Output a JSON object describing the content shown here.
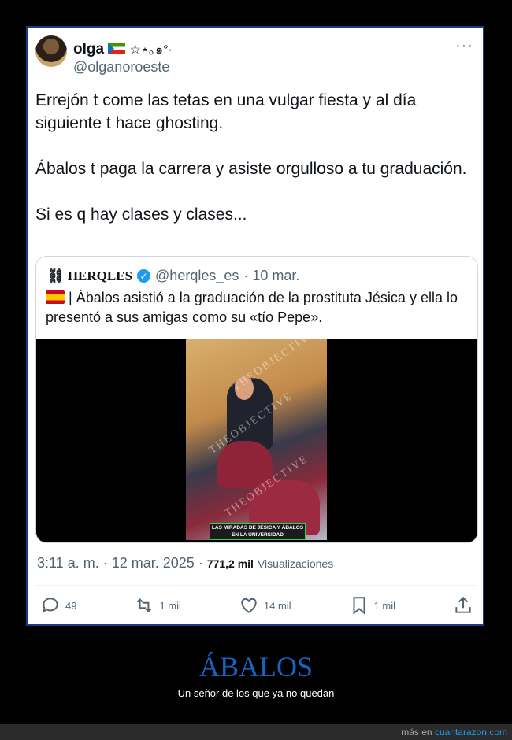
{
  "tweet": {
    "display_name": "olga",
    "name_decor": "☆⋆｡๑°·",
    "handle": "@olganoroeste",
    "more": "···",
    "paragraphs": [
      "Errejón t come las tetas en una vulgar fiesta y al día siguiente t hace ghosting.",
      "Ábalos t paga la carrera y asiste orgulloso a tu graduación.",
      "Si es q hay clases y clases..."
    ],
    "time": "3:11 a. m. · 12 mar. 2025 ·",
    "views_count": "771,2 mil",
    "views_label": "Visualizaciones"
  },
  "quote": {
    "logo": "⛓ HERQLES",
    "handle": "@herqles_es",
    "date": "· 10 mar.",
    "text": "| Ábalos asistió a la graduación de la prostituta Jésica y ella lo presentó a sus amigas como su «tío Pepe».",
    "video_caption": "LAS MIRADAS DE JÉSICA Y ÁBALOS EN LA UNIVERSIDAD",
    "watermark": "THEOBJECTIVE"
  },
  "actions": {
    "replies": "49",
    "retweets": "1 mil",
    "likes": "14 mil",
    "bookmarks": "1 mil"
  },
  "site": {
    "title": "ÁBALOS",
    "subtitle": "Un señor de los que ya no quedan",
    "footer_prefix": "más en",
    "footer_link": "cuantarazon.com"
  },
  "colors": {
    "title": "#1565c0",
    "link": "#1d9bf0",
    "card_border": "#1d3a8a",
    "caption_border": "#2ad35a"
  }
}
